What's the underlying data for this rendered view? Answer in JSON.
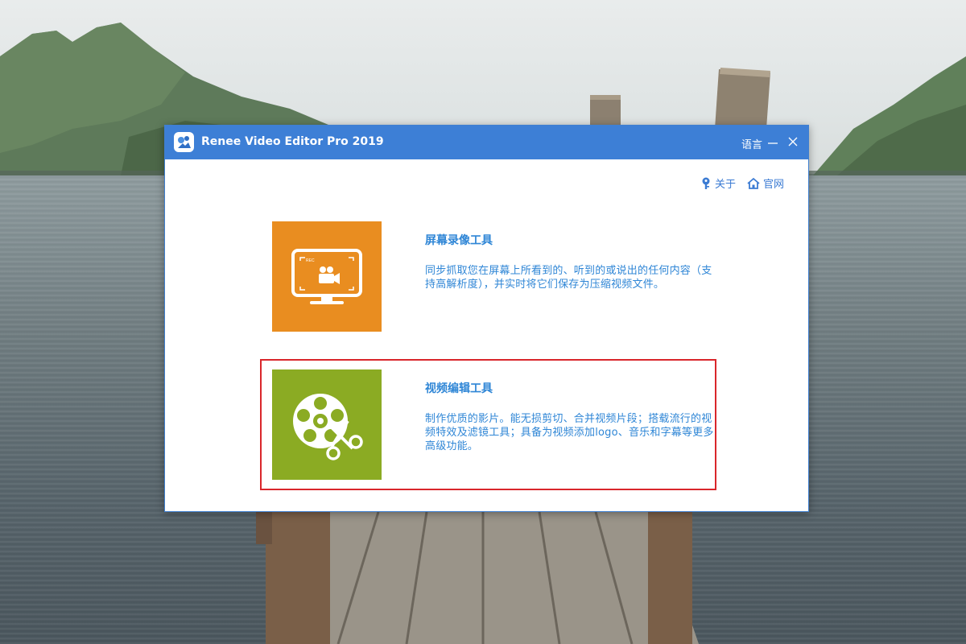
{
  "window": {
    "title": "Renee Video Editor Pro 2019",
    "language_label": "语言",
    "minimize_icon": "minimize-icon",
    "close_icon": "close-icon"
  },
  "links": {
    "about": {
      "label": "关于",
      "icon": "key-icon"
    },
    "website": {
      "label": "官网",
      "icon": "home-icon"
    }
  },
  "cards": {
    "screen_recorder": {
      "title": "屏幕录像工具",
      "description": "同步抓取您在屏幕上所看到的、听到的或说出的任何内容（支持高解析度），并实时将它们保存为压缩视频文件。",
      "tile_color": "#e98d20",
      "icon": "screen-record-icon",
      "icon_text": "REC"
    },
    "video_editor": {
      "title": "视频编辑工具",
      "description": "制作优质的影片。能无损剪切、合并视频片段；搭载流行的视频特效及滤镜工具；具备为视频添加logo、音乐和字幕等更多高级功能。",
      "tile_color": "#8bab23",
      "icon": "film-reel-scissors-icon",
      "highlighted": true,
      "highlight_color": "#d9262b"
    }
  },
  "colors": {
    "titlebar": "#3d7fd6",
    "accent_text": "#2f86d6"
  }
}
